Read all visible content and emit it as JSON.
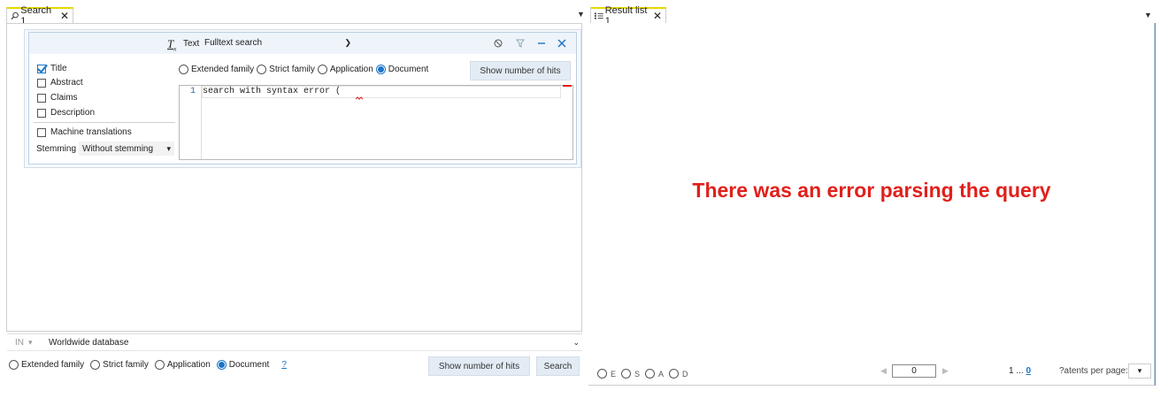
{
  "left_tab": {
    "icon": "search-icon",
    "label": "Search 1",
    "close": "✕"
  },
  "right_tab": {
    "icon": "list-icon",
    "label": "Result list 1",
    "close": "✕"
  },
  "tab_menu_glyph": "▼",
  "query_block": {
    "field_type_label": "Text",
    "field_type_value": "Fulltext search",
    "fields": [
      {
        "label": "Title",
        "checked": true
      },
      {
        "label": "Abstract",
        "checked": false
      },
      {
        "label": "Claims",
        "checked": false
      },
      {
        "label": "Description",
        "checked": false
      }
    ],
    "machine_translations": "Machine translations",
    "stemming_label": "Stemming",
    "stemming_value": "Without stemming",
    "family_options": [
      {
        "label": "Extended family",
        "checked": false
      },
      {
        "label": "Strict family",
        "checked": false
      },
      {
        "label": "Application",
        "checked": false
      },
      {
        "label": "Document",
        "checked": true
      }
    ],
    "show_hits_label": "Show number of hits",
    "editor": {
      "line_number": "1",
      "text": "search with syntax error ("
    }
  },
  "bottom_bar": {
    "in_label": "IN",
    "database": "Worldwide database",
    "family_options": [
      {
        "label": "Extended family",
        "checked": false
      },
      {
        "label": "Strict family",
        "checked": false
      },
      {
        "label": "Application",
        "checked": false
      },
      {
        "label": "Document",
        "checked": true
      }
    ],
    "help": "?",
    "show_hits_label": "Show number of hits",
    "search_label": "Search"
  },
  "results": {
    "error_message": "There was an error parsing the query",
    "error_color": "#e0201b",
    "view_options": [
      {
        "label": "E",
        "checked": false
      },
      {
        "label": "S",
        "checked": false
      },
      {
        "label": "A",
        "checked": false
      },
      {
        "label": "D",
        "checked": false
      }
    ],
    "page_value": "0",
    "range_prefix": "1 ... ",
    "range_link": "0",
    "per_page_label": "?atents per page:"
  },
  "accent_color": "#1a74c9"
}
